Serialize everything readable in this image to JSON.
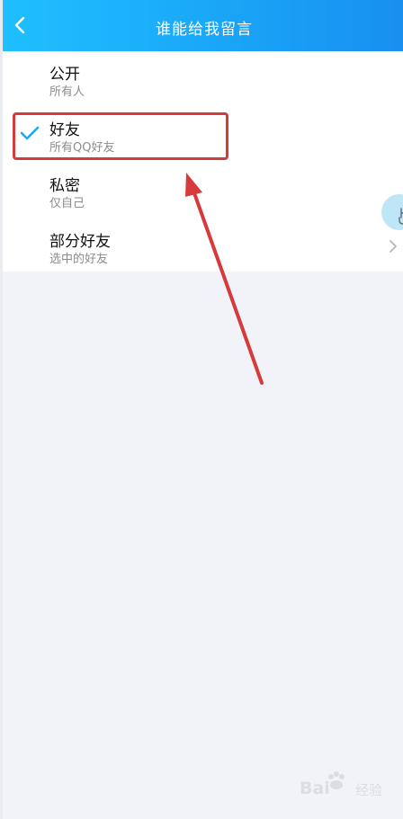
{
  "header": {
    "title": "谁能给我留言",
    "back_icon": "chevron-left-icon"
  },
  "options": [
    {
      "title": "公开",
      "subtitle": "所有人",
      "selected": false
    },
    {
      "title": "好友",
      "subtitle": "所有QQ好友",
      "selected": true
    },
    {
      "title": "私密",
      "subtitle": "仅自己",
      "selected": false
    },
    {
      "title": "部分好友",
      "subtitle": "选中的好友",
      "selected": false,
      "has_chevron": true
    }
  ],
  "colors": {
    "header_gradient_start": "#1fc0ff",
    "header_gradient_end": "#188ff0",
    "check": "#1aa8f8",
    "annotation": "#d63b3b",
    "background": "#f1f3f8"
  },
  "watermark": {
    "text": "Bai",
    "sub": "经验"
  }
}
